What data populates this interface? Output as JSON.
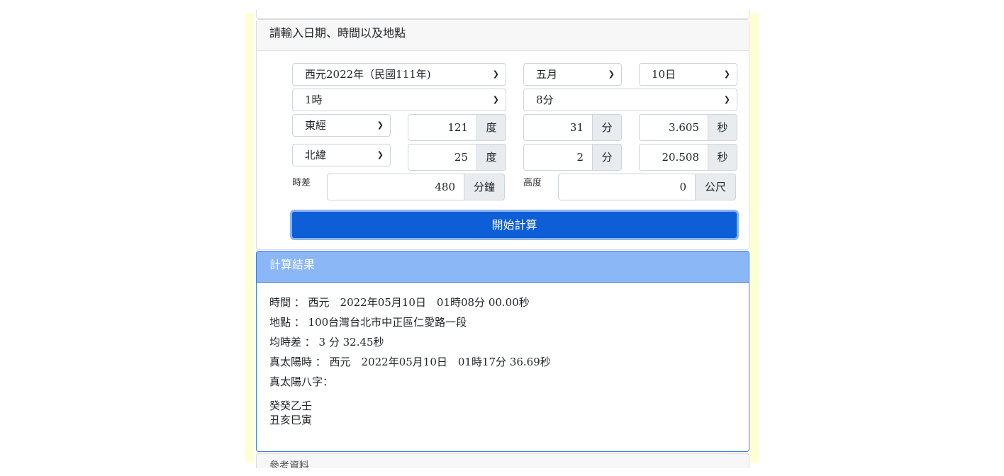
{
  "input_card": {
    "title": "請輸入日期、時間以及地點",
    "year_select": "西元2022年（民國111年)",
    "month_select": "五月",
    "day_select": "10日",
    "hour_select": "1時",
    "minute_select": "8分",
    "longitude": {
      "direction": "東經",
      "degrees": "121",
      "degrees_unit": "度",
      "minutes": "31",
      "minutes_unit": "分",
      "seconds": "3.605",
      "seconds_unit": "秒"
    },
    "latitude": {
      "direction": "北緯",
      "degrees": "25",
      "degrees_unit": "度",
      "minutes": "2",
      "minutes_unit": "分",
      "seconds": "20.508",
      "seconds_unit": "秒"
    },
    "timezone_label": "時差",
    "timezone_value": "480",
    "timezone_unit": "分鐘",
    "altitude_label": "高度",
    "altitude_value": "0",
    "altitude_unit": "公尺",
    "calculate_button": "開始計算"
  },
  "result_card": {
    "title": "計算結果",
    "lines": [
      "時間 ： 西元　2022年05月10日　01時08分 00.00秒",
      "地點 ： 100台灣台北市中正區仁愛路一段",
      "均時差 ： 3 分 32.45秒",
      "真太陽時 ： 西元　2022年05月10日　01時17分 36.69秒",
      "真太陽八字："
    ],
    "bazi_line1": "癸癸乙壬",
    "bazi_line2": "丑亥巳寅"
  },
  "bottom_card": {
    "title": "參考資料"
  },
  "icons": {
    "select_arrow": "chevron-down-icon"
  },
  "colors": {
    "button": "#0d5ed7",
    "result_header": "#8bb7f7",
    "side_strip": "#ffffd6"
  }
}
